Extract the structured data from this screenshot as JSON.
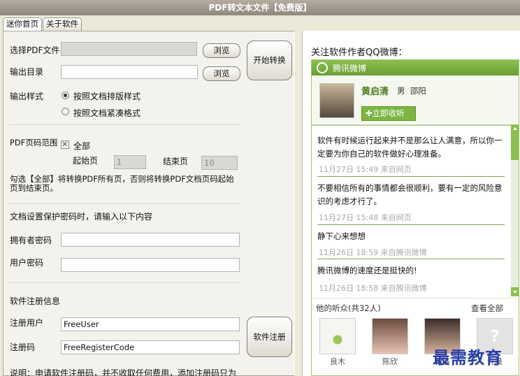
{
  "window": {
    "title": "PDF转文本文件【免费版】"
  },
  "tabs": [
    {
      "label": "迷你首页"
    },
    {
      "label": "关于软件"
    }
  ],
  "form": {
    "pdf_file_label": "选择PDF文件",
    "output_dir_label": "输出目录",
    "browse_label": "浏览",
    "start_label": "开始转换",
    "output_style_label": "输出样式",
    "style_option_1": "按照文档排版样式",
    "style_option_2": "按照文档紧凑格式",
    "page_range_label": "PDF页码范围",
    "all_label": "全部",
    "start_page_label": "起始页",
    "start_page_value": "1",
    "end_page_label": "结束页",
    "end_page_value": "10",
    "range_hint": "勾选【全部】将转换PDF所有页，否则将转换PDF文档页码起始页到结束页。",
    "password_hint": "文档设置保护密码时，请输入以下内容",
    "owner_pwd_label": "拥有者密码",
    "user_pwd_label": "用户密码",
    "reg_info_label": "软件注册信息",
    "reg_user_label": "注册用户",
    "reg_user_value": "FreeUser",
    "reg_code_label": "注册码",
    "reg_code_value": "FreeRegisterCode",
    "reg_button": "软件注册",
    "note": "说明：申请软件注册码，并不收取任何费用，添加注册码只为"
  },
  "weibo": {
    "follow_title": "关注软件作者QQ微博：",
    "brand": "腾讯微博",
    "user_name": "黄启清",
    "user_gender": "男",
    "user_location": "邵阳",
    "follow_button": "立即收听",
    "posts": [
      {
        "text": "软件有时候运行起来并不是那么让人满意，所以你一定要为你自己的软件做好心理准备。",
        "time": "11月27日 15:49 来自网页"
      },
      {
        "text": "不要相信所有的事情都会很顺利，要有一定的风险意识的考虑才行了。",
        "time": "11月27日 15:48 来自网页"
      },
      {
        "text": "静下心来想想",
        "time": "11月26日 18:59 来自腾讯微博"
      },
      {
        "text": "腾讯微博的速度还是挺快的!",
        "time": "11月26日 18:58 来自腾讯微博"
      }
    ],
    "fans_title": "他的听众(共32人)",
    "view_all": "查看全部",
    "fans": [
      {
        "name": "良木"
      },
      {
        "name": "陈欣"
      },
      {
        "name": "袍鑫"
      },
      {
        "name": "许晨"
      }
    ]
  },
  "watermark": "最需教育"
}
